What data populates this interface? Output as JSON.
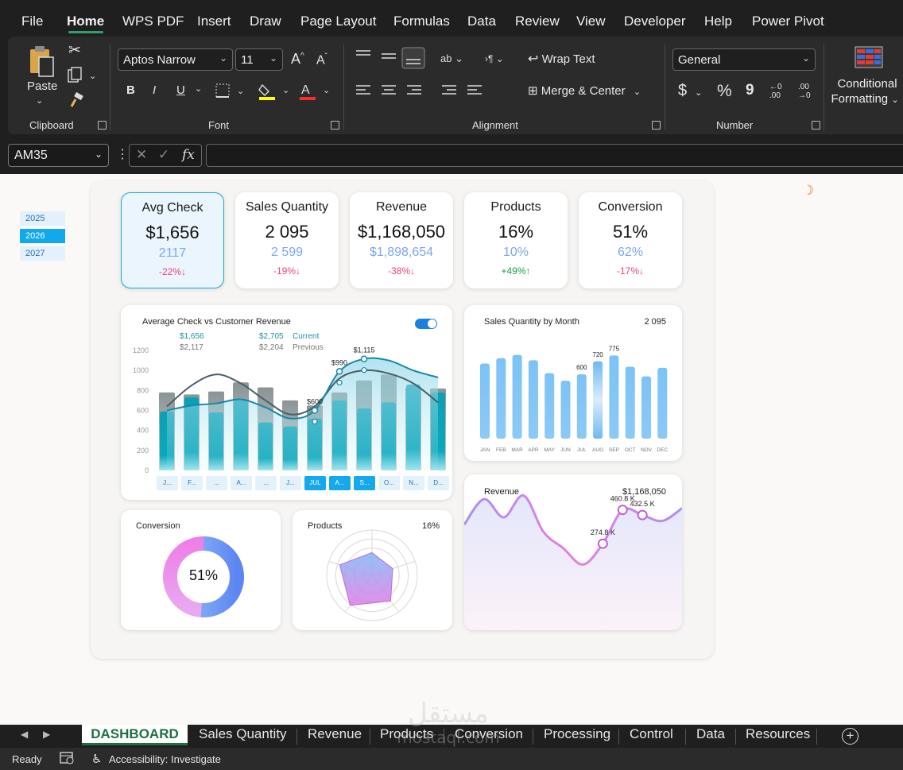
{
  "menu": {
    "items": [
      "File",
      "Home",
      "WPS PDF",
      "Insert",
      "Draw",
      "Page Layout",
      "Formulas",
      "Data",
      "Review",
      "View",
      "Developer",
      "Help",
      "Power Pivot"
    ],
    "active": "Home"
  },
  "ribbon": {
    "clipboard": {
      "paste_label": "Paste",
      "group_label": "Clipboard"
    },
    "font": {
      "family": "Aptos Narrow",
      "size": "11",
      "group_label": "Font",
      "bold": "B",
      "italic": "I",
      "underline": "U",
      "grow": "A",
      "shrink": "A",
      "highlight_color": "#ffff00",
      "font_color": "#ff2b2b"
    },
    "alignment": {
      "wrap_text": "Wrap Text",
      "merge_center": "Merge & Center",
      "group_label": "Alignment"
    },
    "number": {
      "format": "General",
      "group_label": "Number",
      "currency": "$",
      "percent": "%",
      "comma": "9"
    },
    "styles": {
      "conditional_formatting_line1": "Conditional",
      "conditional_formatting_line2": "Formatting"
    }
  },
  "formula_bar": {
    "name_box": "AM35",
    "fx": "fx",
    "formula": ""
  },
  "years": [
    "2025",
    "2026",
    "2027"
  ],
  "selected_year": "2026",
  "kpis": [
    {
      "title": "Avg Check",
      "value": "$1,656",
      "previous": "2117",
      "delta": "-22%↓",
      "delta_color": "#e8437a"
    },
    {
      "title": "Sales Quantity",
      "value": "2 095",
      "previous": "2 599",
      "delta": "-19%↓",
      "delta_color": "#e8437a"
    },
    {
      "title": "Revenue",
      "value": "$1,168,050",
      "previous": "$1,898,654",
      "delta": "-38%↓",
      "delta_color": "#e8437a"
    },
    {
      "title": "Products",
      "value": "16%",
      "previous": "10%",
      "delta": "+49%↑",
      "delta_color": "#1e9e4a"
    },
    {
      "title": "Conversion",
      "value": "51%",
      "previous": "62%",
      "delta": "-17%↓",
      "delta_color": "#e8437a"
    }
  ],
  "avg_check_chart": {
    "title": "Average Check vs Customer Revenue",
    "legend": {
      "current_avg": "$1,656",
      "current_rev": "$2,705",
      "current_label": "Current",
      "previous_avg": "$2,117",
      "previous_rev": "$2,204",
      "previous_label": "Previous"
    },
    "annotations": [
      "$600",
      "$990",
      "$1,115"
    ],
    "month_buttons": [
      "J...",
      "F...",
      "...",
      "A...",
      "...",
      "J...",
      "JUL",
      "A...",
      "S...",
      "O...",
      "N...",
      "D..."
    ]
  },
  "sales_chart": {
    "title": "Sales Quantity by Month",
    "total": "2 095"
  },
  "revenue_chart": {
    "title": "Revenue",
    "total": "$1,168,050",
    "labels": [
      "274.8 K",
      "460.8 K",
      "432.5 K"
    ]
  },
  "conversion_chart": {
    "title": "Conversion",
    "value": "51%"
  },
  "products_chart": {
    "title": "Products",
    "value": "16%"
  },
  "chart_data": [
    {
      "type": "bar",
      "title": "Average Check vs Customer Revenue",
      "categories": [
        "JAN",
        "FEB",
        "MAR",
        "APR",
        "MAY",
        "JUN",
        "JUL",
        "AUG",
        "SEP",
        "OCT",
        "NOV",
        "DEC"
      ],
      "ylim": [
        0,
        1200
      ],
      "yticks": [
        0,
        200,
        400,
        600,
        800,
        1000,
        1200
      ],
      "series": [
        {
          "name": "Previous",
          "values": [
            780,
            760,
            790,
            880,
            830,
            700,
            650,
            780,
            900,
            960,
            830,
            820
          ]
        },
        {
          "name": "Current",
          "values": [
            590,
            730,
            580,
            700,
            480,
            440,
            520,
            700,
            620,
            680,
            860,
            780
          ]
        }
      ],
      "lines": [
        {
          "values": [
            640,
            850,
            960,
            870,
            700,
            560,
            640,
            920,
            1000,
            970,
            870,
            680
          ]
        },
        {
          "values": [
            600,
            650,
            670,
            710,
            630,
            520,
            600,
            990,
            1115,
            1100,
            1000,
            930
          ]
        }
      ]
    },
    {
      "type": "bar",
      "title": "Sales Quantity by Month",
      "categories": [
        "JAN",
        "FEB",
        "MAR",
        "APR",
        "MAY",
        "JUN",
        "JUL",
        "AUG",
        "SEP",
        "OCT",
        "NOV",
        "DEC"
      ],
      "values": [
        700,
        750,
        780,
        730,
        610,
        540,
        600,
        720,
        775,
        670,
        580,
        660
      ],
      "ylim": [
        0,
        900
      ],
      "data_labels": [
        "",
        "",
        "",
        "",
        "",
        "",
        "600",
        "720",
        "775",
        "",
        "",
        ""
      ]
    },
    {
      "type": "area",
      "title": "Revenue",
      "values": [
        380,
        520,
        420,
        540,
        340,
        250,
        160,
        274.8,
        460.8,
        432.5,
        400,
        470
      ],
      "ylim": [
        0,
        700
      ],
      "data_labels": [
        "",
        "",
        "",
        "",
        "",
        "",
        "",
        "274.8 K",
        "460.8 K",
        "432.5 K",
        "",
        ""
      ]
    },
    {
      "type": "pie",
      "title": "Conversion",
      "values": [
        51,
        49
      ],
      "labels": [
        "51%"
      ]
    },
    {
      "type": "radar",
      "title": "Products",
      "values": [
        50,
        48,
        70,
        82,
        75
      ],
      "range": [
        0,
        100
      ]
    }
  ],
  "sheet_tabs": [
    "DASHBOARD",
    "Sales Quantity",
    "Revenue",
    "Products",
    "Conversion",
    "Processing",
    "Control",
    "Data",
    "Resources"
  ],
  "active_tab": "DASHBOARD",
  "status": {
    "ready": "Ready",
    "accessibility": "Accessibility: Investigate"
  },
  "watermark": {
    "arabic": "مستقل",
    "latin": "mostaql.com"
  }
}
